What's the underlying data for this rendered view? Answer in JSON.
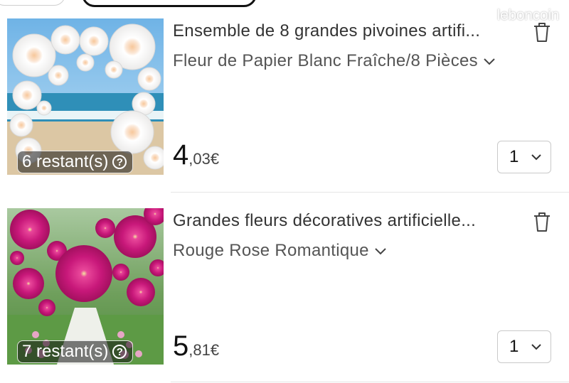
{
  "watermark": "leboncoin",
  "items": [
    {
      "title": "Ensemble de 8 grandes pivoines artifi...",
      "variant": "Fleur de Papier Blanc Fraîche/8 Pièces",
      "stock": "6 restant(s)",
      "help_glyph": "?",
      "price_int": "4",
      "price_dec": ",03€",
      "quantity": "1",
      "image": "white-paper-flower-arch-beach"
    },
    {
      "title": "Grandes fleurs décoratives artificielle...",
      "variant": "Rouge Rose Romantique",
      "stock": "7 restant(s)",
      "help_glyph": "?",
      "price_int": "5",
      "price_dec": ",81€",
      "quantity": "1",
      "image": "magenta-paper-flowers-garden"
    }
  ],
  "colors": {
    "accent": "#111111",
    "divider": "#e6e6e6",
    "magenta": "#c8187a"
  }
}
